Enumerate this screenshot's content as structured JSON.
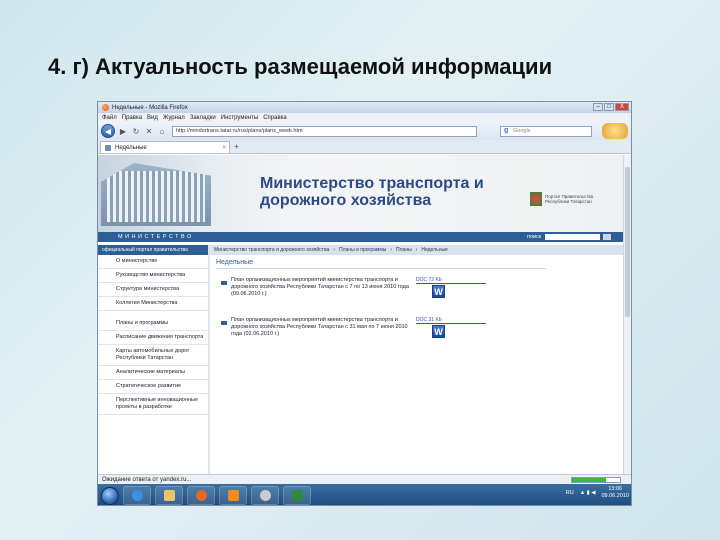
{
  "slide": {
    "title": "4. г) Актуальность размещаемой информации"
  },
  "window": {
    "title": "Недельные - Mozilla Firefox",
    "controls": [
      "–",
      "□",
      "X"
    ]
  },
  "menu": [
    "Файл",
    "Правка",
    "Вид",
    "Журнал",
    "Закладки",
    "Инструменты",
    "Справка"
  ],
  "navbar": {
    "url": "http://mindortrans.tatar.ru/rus/plans/plans_week.htm",
    "search_placeholder": "Google"
  },
  "tab": {
    "label": "Недельные"
  },
  "site": {
    "ministry_line1": "Министерство транспорта и",
    "ministry_line2": "дорожного хозяйства",
    "emblem_text": "Портал Правительства Республики Татарстан",
    "site_name": "МИНИСТЕРСТВО",
    "search_label": "поиск",
    "breadcrumb_left": "официальный портал правительства",
    "breadcrumb": [
      "Министерство транспорта и дорожного хозяйства",
      "Планы и программы",
      "Планы",
      "Недельные"
    ]
  },
  "sidebar": {
    "items": [
      "О министерстве",
      "Руководство министерства",
      "Структура министерства",
      "Коллегия Министерства",
      "Планы и программы",
      "Расписание движения транспорта",
      "Карты автомобильных дорог Республики Татарстан",
      "Аналитические материалы",
      "Стратегическое развитие",
      "Перспективные инновационные проекты в разработке"
    ]
  },
  "main": {
    "heading": "Недельные",
    "docs": [
      {
        "text": "План организационных мероприятий министерства транспорта и дорожного хозяйства Республики Татарстан с 7 по 13 июня 2010 года (09.06.2010 г.)",
        "size": "DOC 72 Kb",
        "icon": "word-icon"
      },
      {
        "text": "План организационных мероприятий министерства транспорта и дорожного хозяйства Республики Татарстан с 31 мая по 7 июня 2010 года (02.06.2010 г.)",
        "size": "DOC 31 Kb",
        "icon": "word-icon"
      }
    ]
  },
  "status": {
    "text": "Ожидание ответа от yandex.ru...",
    "progress": 0.7
  },
  "taskbar": {
    "lang": "RU",
    "time": "13:06",
    "date": "09.06.2010",
    "apps": [
      "ie-icon",
      "explorer-icon",
      "firefox-icon",
      "media-player-icon",
      "settings-icon",
      "excel-icon"
    ]
  },
  "colors": {
    "accent": "#2f5e96",
    "taskbar": "#1e4a7c",
    "title_text": "#2a4a8a"
  }
}
